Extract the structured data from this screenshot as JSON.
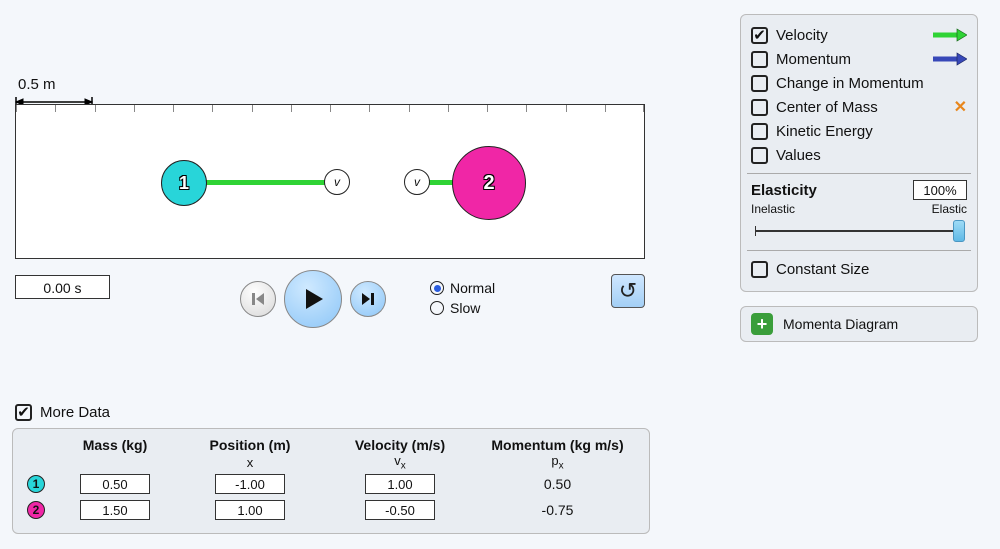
{
  "scale_label": "0.5 m",
  "time": "0.00 s",
  "speed": {
    "normal": "Normal",
    "slow": "Slow",
    "selected": "normal"
  },
  "options": {
    "velocity": {
      "label": "Velocity",
      "checked": true
    },
    "momentum": {
      "label": "Momentum",
      "checked": false
    },
    "change": {
      "label": "Change in Momentum",
      "checked": false
    },
    "com": {
      "label": "Center of Mass",
      "checked": false
    },
    "ke": {
      "label": "Kinetic Energy",
      "checked": false
    },
    "values": {
      "label": "Values",
      "checked": false
    },
    "constant": {
      "label": "Constant Size",
      "checked": false
    }
  },
  "elasticity": {
    "label": "Elasticity",
    "value": "100%",
    "inelastic": "Inelastic",
    "elastic": "Elastic"
  },
  "arrow_colors": {
    "velocity": "#2fd335",
    "momentum": "#3748b8"
  },
  "momenta_diagram": "Momenta Diagram",
  "more_data": {
    "label": "More Data",
    "checked": true
  },
  "table": {
    "headers": {
      "mass": "Mass (kg)",
      "position": "Position (m)",
      "velocity": "Velocity (m/s)",
      "momentum": "Momentum (kg m/s)"
    },
    "sub": {
      "position": "x",
      "velocity": "v",
      "velocity_sub": "x",
      "momentum": "p",
      "momentum_sub": "x"
    },
    "rows": [
      {
        "id": "1",
        "mass": "0.50",
        "position": "-1.00",
        "velocity": "1.00",
        "momentum": "0.50"
      },
      {
        "id": "2",
        "mass": "1.50",
        "position": "1.00",
        "velocity": "-0.50",
        "momentum": "-0.75"
      }
    ]
  },
  "balls": {
    "1": "1",
    "2": "2"
  },
  "v_label": "v"
}
